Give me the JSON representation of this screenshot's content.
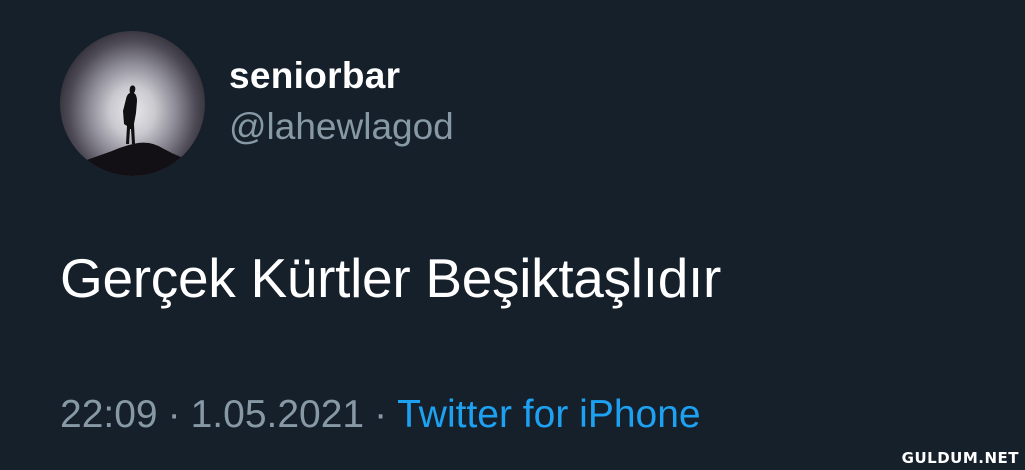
{
  "colors": {
    "background": "#15202b",
    "primary_text": "#ffffff",
    "secondary_text": "#8899a6",
    "link": "#1da1f2"
  },
  "user": {
    "display_name": "seniorbar",
    "handle": "@lahewlagod",
    "avatar_icon": "profile-photo-silhouette"
  },
  "tweet": {
    "text": "Gerçek Kürtler Beşiktaşlıdır",
    "time": "22:09",
    "separator": "·",
    "date": "1.05.2021",
    "source": "Twitter for iPhone"
  },
  "watermark": "GULDUM.NET"
}
